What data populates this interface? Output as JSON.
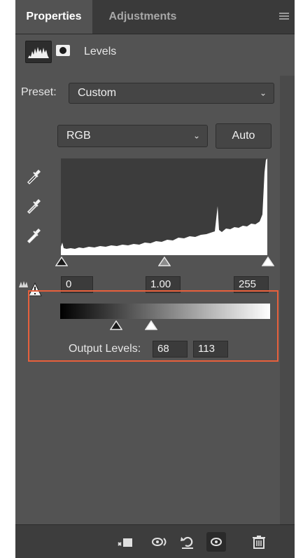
{
  "tabs": {
    "active": "Properties",
    "inactive": "Adjustments"
  },
  "adjustment": {
    "title": "Levels"
  },
  "preset": {
    "label": "Preset:",
    "value": "Custom"
  },
  "channel": {
    "value": "RGB"
  },
  "buttons": {
    "auto": "Auto"
  },
  "input_levels": {
    "black": "0",
    "gamma": "1.00",
    "white": "255"
  },
  "output_levels": {
    "label": "Output Levels:",
    "black": "68",
    "white": "113"
  },
  "highlight_color": "#e8603c",
  "icons": {
    "panel_menu": "menu-icon",
    "histogram": "histogram-thumbnail-icon",
    "mask": "mask-icon",
    "eyedroppers": [
      "black-point-eyedropper-icon",
      "gray-point-eyedropper-icon",
      "white-point-eyedropper-icon"
    ],
    "clipping": "clipping-warning-icon",
    "bottom": [
      "clip-to-layer-icon",
      "view-previous-state-icon",
      "reset-icon",
      "toggle-visibility-icon",
      "delete-icon"
    ]
  }
}
